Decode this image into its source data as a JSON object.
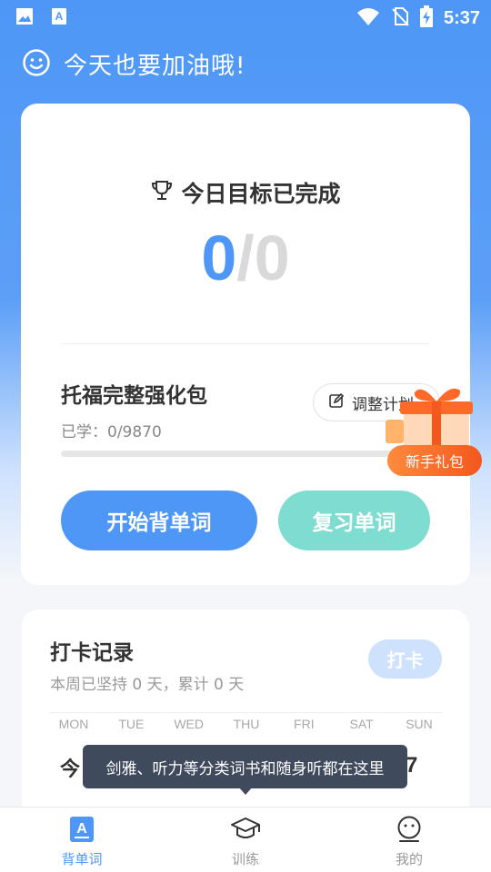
{
  "status_bar": {
    "time": "5:37"
  },
  "header": {
    "title": "今天也要加油哦!"
  },
  "goal": {
    "title": "今日目标已完成",
    "done": "0",
    "separator": "/",
    "total": "0"
  },
  "book": {
    "title": "托福完整强化包",
    "learned": "已学：0/9870",
    "progress": 0
  },
  "adjust_plan": {
    "label": "调整计划"
  },
  "actions": {
    "start": "开始背单词",
    "review": "复习单词"
  },
  "gift": {
    "label": "新手礼包"
  },
  "checkin": {
    "title": "打卡记录",
    "subtitle": "本周已坚持 0 天，累计 0 天",
    "button": "打卡",
    "weekdays": [
      "MON",
      "TUE",
      "WED",
      "THU",
      "FRI",
      "SAT",
      "SUN"
    ],
    "today": "今",
    "last_day": "7"
  },
  "tooltip": {
    "text": "剑雅、听力等分类词书和随身听都在这里"
  },
  "tabs": [
    {
      "label": "背单词",
      "icon": "book-a-icon",
      "active": true
    },
    {
      "label": "训练",
      "icon": "graduation-cap-icon",
      "active": false
    },
    {
      "label": "我的",
      "icon": "profile-icon",
      "active": false
    }
  ],
  "colors": {
    "primary": "#4e97f6",
    "review_button": "#7fdcd0",
    "gift_orange": "#f3581c",
    "tooltip_bg": "#3f4a5c"
  }
}
